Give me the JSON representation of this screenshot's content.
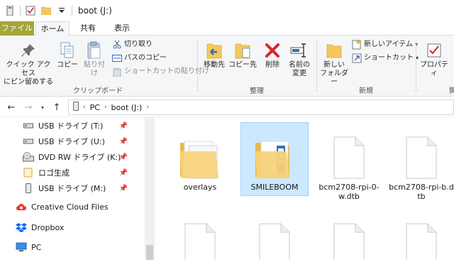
{
  "titlebar": {
    "title": "boot (J:)",
    "quick_access_icons": [
      "drive-icon",
      "properties-icon",
      "new-folder-icon",
      "customize-dropdown-icon"
    ]
  },
  "tabs": {
    "file": "ファイル",
    "home": "ホーム",
    "share": "共有",
    "view": "表示"
  },
  "ribbon": {
    "clipboard": {
      "pin_label_1": "クイック アクセス",
      "pin_label_2": "にピン留めする",
      "copy": "コピー",
      "paste": "貼り付け",
      "cut": "切り取り",
      "copy_path": "パスのコピー",
      "paste_shortcut": "ショートカットの貼り付け",
      "group_label": "クリップボード"
    },
    "organize": {
      "move_to": "移動先",
      "copy_to": "コピー先",
      "delete": "削除",
      "rename_1": "名前の",
      "rename_2": "変更",
      "group_label": "整理"
    },
    "new": {
      "new_folder_1": "新しい",
      "new_folder_2": "フォルダー",
      "new_item": "新しいアイテム",
      "shortcut": "ショートカット",
      "group_label": "新規"
    },
    "open": {
      "properties": "プロパティ",
      "group_label": "開"
    }
  },
  "address": {
    "crumbs": [
      "PC",
      "boot (J:)"
    ],
    "back": "←",
    "forward": "→",
    "up": "↑"
  },
  "navpane": {
    "items": [
      {
        "label": "USB ドライブ (T:)",
        "icon": "usb-drive-icon",
        "pinned": true
      },
      {
        "label": "USB ドライブ (U:)",
        "icon": "usb-drive-icon",
        "pinned": true
      },
      {
        "label": "DVD RW ドライブ (K:)",
        "icon": "dvd-drive-icon",
        "pinned": true
      },
      {
        "label": "ロゴ生成",
        "icon": "folder-icon",
        "pinned": true
      },
      {
        "label": "USB ドライブ (M:)",
        "icon": "usb-drive-icon",
        "pinned": true
      },
      {
        "label": "Creative Cloud Files",
        "icon": "creative-cloud-icon",
        "pinned": false
      },
      {
        "label": "Dropbox",
        "icon": "dropbox-icon",
        "pinned": false
      },
      {
        "label": "PC",
        "icon": "pc-icon",
        "pinned": false
      }
    ]
  },
  "files": [
    {
      "name": "overlays",
      "type": "folder",
      "selected": false
    },
    {
      "name": "SMILEBOOM",
      "type": "folder",
      "selected": true
    },
    {
      "name": "bcm2708-rpi-0-w.dtb",
      "type": "file",
      "selected": false
    },
    {
      "name": "bcm2708-rpi-b.dtb",
      "type": "file",
      "selected": false
    }
  ],
  "colors": {
    "file_tab": "#a4a53a",
    "selection": "#cce8ff",
    "folder": "#f4c85a",
    "delete": "#d4262d"
  }
}
